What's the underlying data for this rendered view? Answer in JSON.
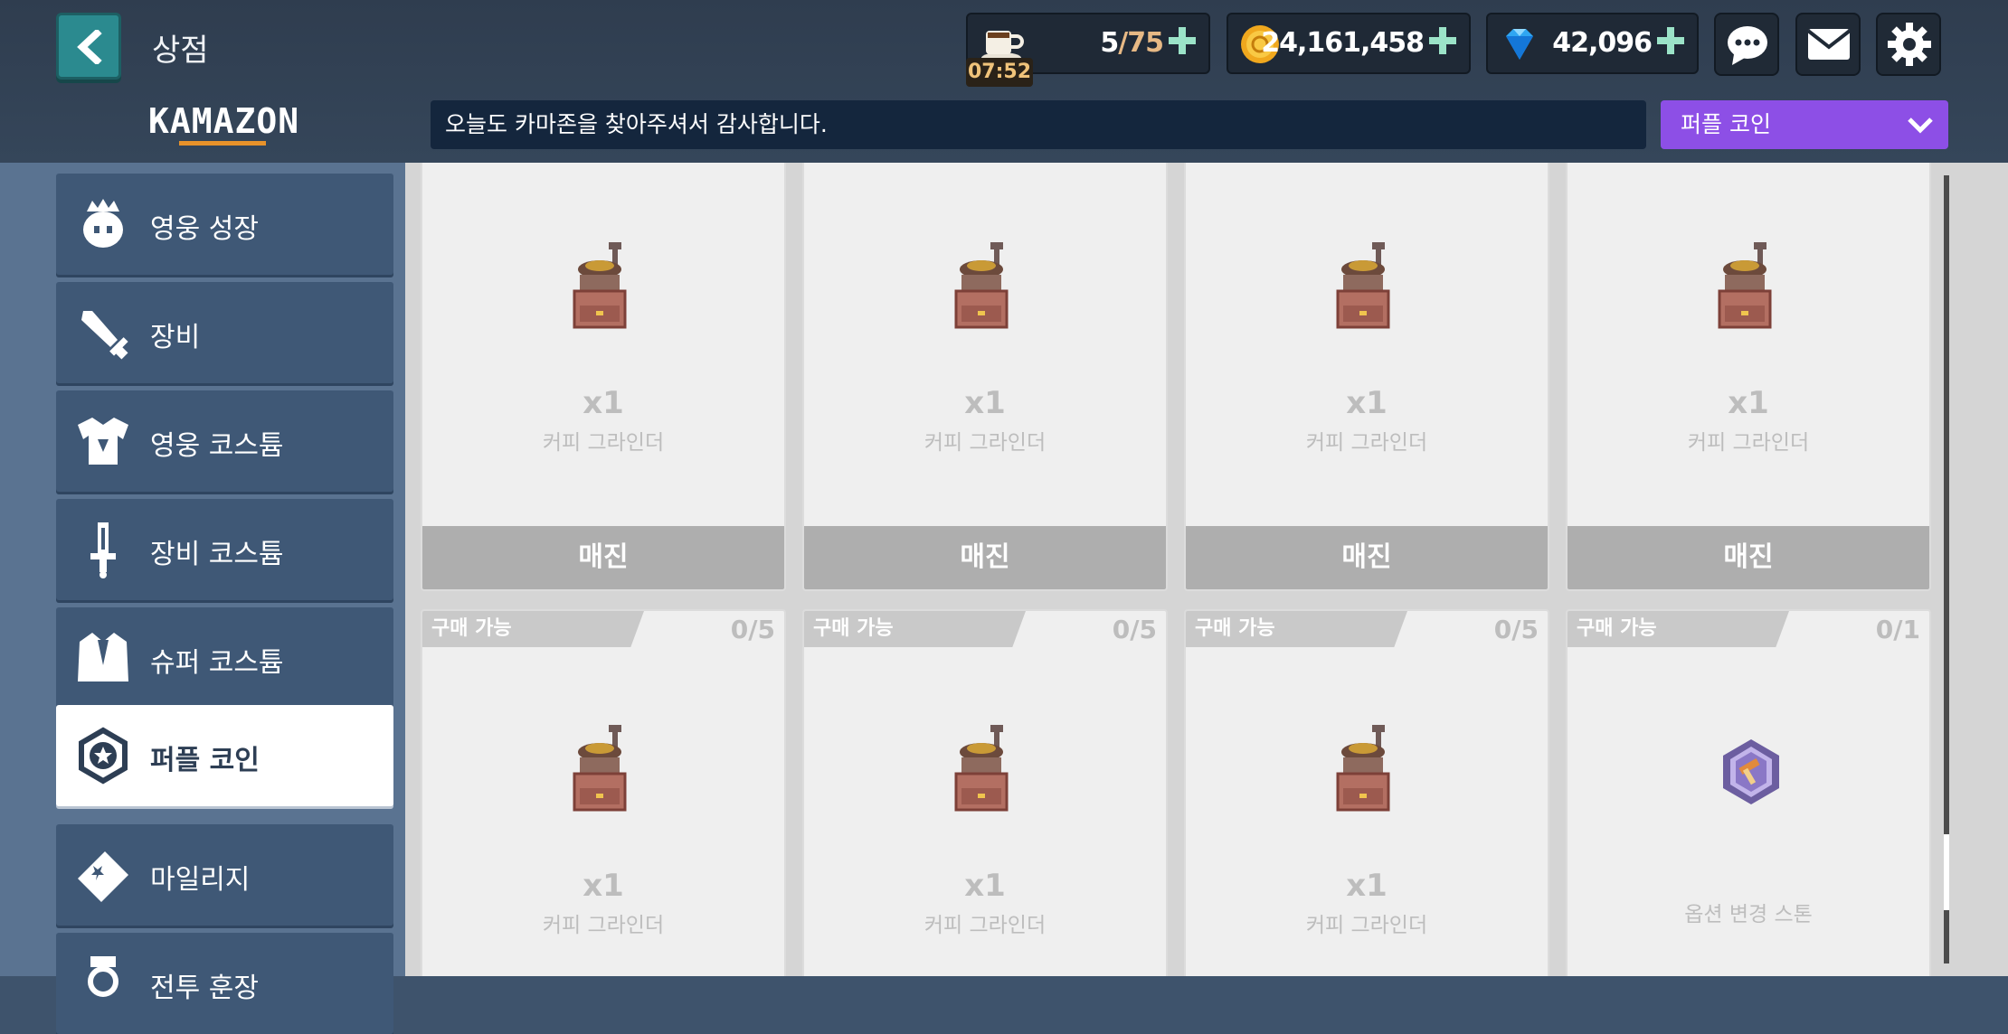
{
  "header": {
    "title": "상점",
    "brand": "KAMAZON",
    "notice": "오늘도 카마존을 찾아주셔서 감사합니다.",
    "dropdown_selected": "퍼플 코인"
  },
  "resources": {
    "stamina": {
      "current": "5",
      "max": "/75",
      "timer": "07:52",
      "icon": "coffee-cup-icon"
    },
    "gold": {
      "value": "24,161,458",
      "icon": "gold-coin-icon"
    },
    "gem": {
      "value": "42,096",
      "icon": "diamond-icon"
    }
  },
  "top_buttons": [
    "chat-icon",
    "mail-icon",
    "settings-icon"
  ],
  "sidebar": {
    "items": [
      {
        "label": "영웅 성장",
        "icon": "hero-face-icon",
        "active": false
      },
      {
        "label": "장비",
        "icon": "sword-icon",
        "active": false
      },
      {
        "label": "영웅 코스튬",
        "icon": "armor-icon",
        "active": false
      },
      {
        "label": "장비 코스튬",
        "icon": "dagger-icon",
        "active": false
      },
      {
        "label": "슈퍼 코스튬",
        "icon": "suit-icon",
        "active": false
      },
      {
        "label": "퍼플 코인",
        "icon": "star-badge-icon",
        "active": true
      },
      {
        "label": "마일리지",
        "icon": "ticket-icon",
        "active": false
      },
      {
        "label": "전투 훈장",
        "icon": "medal-icon",
        "active": false
      }
    ]
  },
  "shop": {
    "row1": [
      {
        "qty": "x1",
        "name": "커피 그라인더",
        "status": "매진",
        "icon": "coffee-grinder-icon"
      },
      {
        "qty": "x1",
        "name": "커피 그라인더",
        "status": "매진",
        "icon": "coffee-grinder-icon"
      },
      {
        "qty": "x1",
        "name": "커피 그라인더",
        "status": "매진",
        "icon": "coffee-grinder-icon"
      },
      {
        "qty": "x1",
        "name": "커피 그라인더",
        "status": "매진",
        "icon": "coffee-grinder-icon"
      }
    ],
    "row2": [
      {
        "tag": "구매 가능",
        "count": "0/5",
        "qty": "x1",
        "name": "커피 그라인더",
        "icon": "coffee-grinder-icon"
      },
      {
        "tag": "구매 가능",
        "count": "0/5",
        "qty": "x1",
        "name": "커피 그라인더",
        "icon": "coffee-grinder-icon"
      },
      {
        "tag": "구매 가능",
        "count": "0/5",
        "qty": "x1",
        "name": "커피 그라인더",
        "icon": "coffee-grinder-icon"
      },
      {
        "tag": "구매 가능",
        "count": "0/1",
        "qty": "",
        "name": "옵션 변경 스톤",
        "icon": "option-stone-icon"
      }
    ]
  }
}
